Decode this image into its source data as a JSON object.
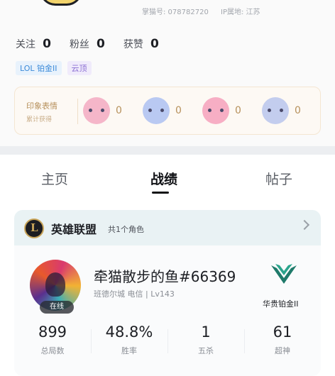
{
  "profile": {
    "id_label": "掌猫号: 078782720",
    "ip_label": "IP属地: 江苏"
  },
  "stats": [
    {
      "label": "关注",
      "value": "0"
    },
    {
      "label": "粉丝",
      "value": "0"
    },
    {
      "label": "获赞",
      "value": "0"
    }
  ],
  "tags": [
    {
      "text": "LOL 铂金II",
      "color": "#3c8bd9"
    },
    {
      "text": "云顶",
      "color": "#8b6fd3"
    }
  ],
  "impression": {
    "title": "印象表情",
    "subtitle": "累计获得",
    "emotes": [
      {
        "icon": "pink-hair-girl-emote",
        "count": "0"
      },
      {
        "icon": "blue-hair-salute-emote",
        "count": "0"
      },
      {
        "icon": "pink-hair-smile-emote",
        "count": "0"
      },
      {
        "icon": "blue-hair-tired-emote",
        "count": "0"
      }
    ]
  },
  "tabs": [
    {
      "label": "主页",
      "active": false
    },
    {
      "label": "战绩",
      "active": true
    },
    {
      "label": "帖子",
      "active": false
    }
  ],
  "game": {
    "name": "英雄联盟",
    "role_count": "共1个角色",
    "player_name": "牵猫散步的鱼#66369",
    "server_info": "班德尔城 电信 | Lv143",
    "online_label": "在线",
    "rank_label": "华贵铂金II",
    "stats": [
      {
        "value": "899",
        "label": "总局数"
      },
      {
        "value": "48.8%",
        "label": "胜率"
      },
      {
        "value": "1",
        "label": "五杀"
      },
      {
        "value": "61",
        "label": "超神"
      }
    ]
  }
}
